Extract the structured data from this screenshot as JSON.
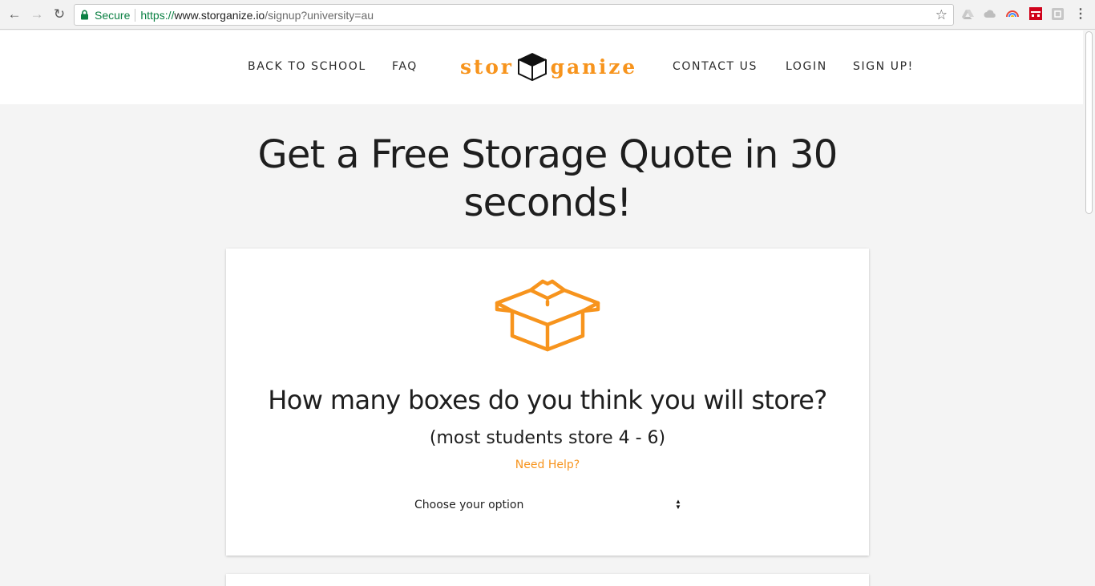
{
  "browser": {
    "secure_label": "Secure",
    "url_protocol": "https://",
    "url_host": "www.storganize.io",
    "url_path": "/signup?university=au"
  },
  "header": {
    "nav_left": [
      "BACK TO SCHOOL",
      "FAQ"
    ],
    "logo_left": "stor",
    "logo_right": "ganize",
    "nav_right": [
      "CONTACT US",
      "LOGIN",
      "SIGN UP!"
    ]
  },
  "main": {
    "headline_line1": "Get a Free Storage Quote in 30",
    "headline_line2": "seconds!",
    "question": "How many boxes do you think you will store?",
    "hint": "(most students store 4 - 6)",
    "help_link": "Need Help?",
    "select_value": "Choose your option"
  },
  "colors": {
    "accent": "#f7941d",
    "text": "#1e1e1e",
    "background": "#f4f4f4"
  }
}
